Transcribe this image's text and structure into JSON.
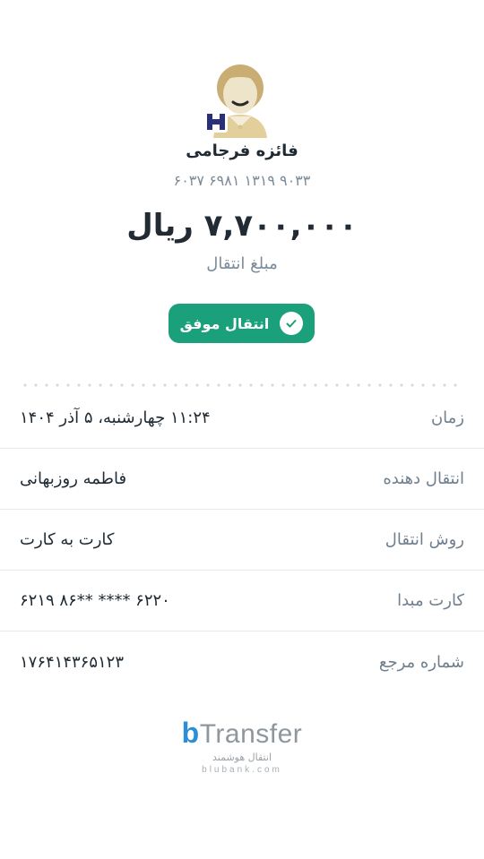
{
  "recipient": {
    "name": "فائزه فرجامی",
    "card_number": "۶۰۳۷ ۶۹۸۱ ۱۳۱۹ ۹۰۳۳"
  },
  "transfer": {
    "amount": "۷,۷۰۰,۰۰۰ ریال",
    "amount_label": "مبلغ انتقال",
    "status": "انتقال موفق"
  },
  "details": [
    {
      "label": "زمان",
      "value": "۱۱:۲۴ چهارشنبه، ۵ آذر ۱۴۰۴"
    },
    {
      "label": "انتقال دهنده",
      "value": "فاطمه روزبهانی"
    },
    {
      "label": "روش انتقال",
      "value": "کارت به کارت"
    },
    {
      "label": "کارت مبدا",
      "value": "۶۲۱۹ ۸۶** **** ۶۲۲۰"
    },
    {
      "label": "شماره مرجع",
      "value": "۱۷۶۴۱۴۳۶۵۱۲۳"
    }
  ],
  "brand": {
    "name": "Transfer",
    "tagline": "انتقال هوشمند",
    "url": "blubank.com"
  },
  "colors": {
    "success": "#1aa07a",
    "brand_blue": "#2b8fd6",
    "bank_logo": "#2a2f7a"
  }
}
